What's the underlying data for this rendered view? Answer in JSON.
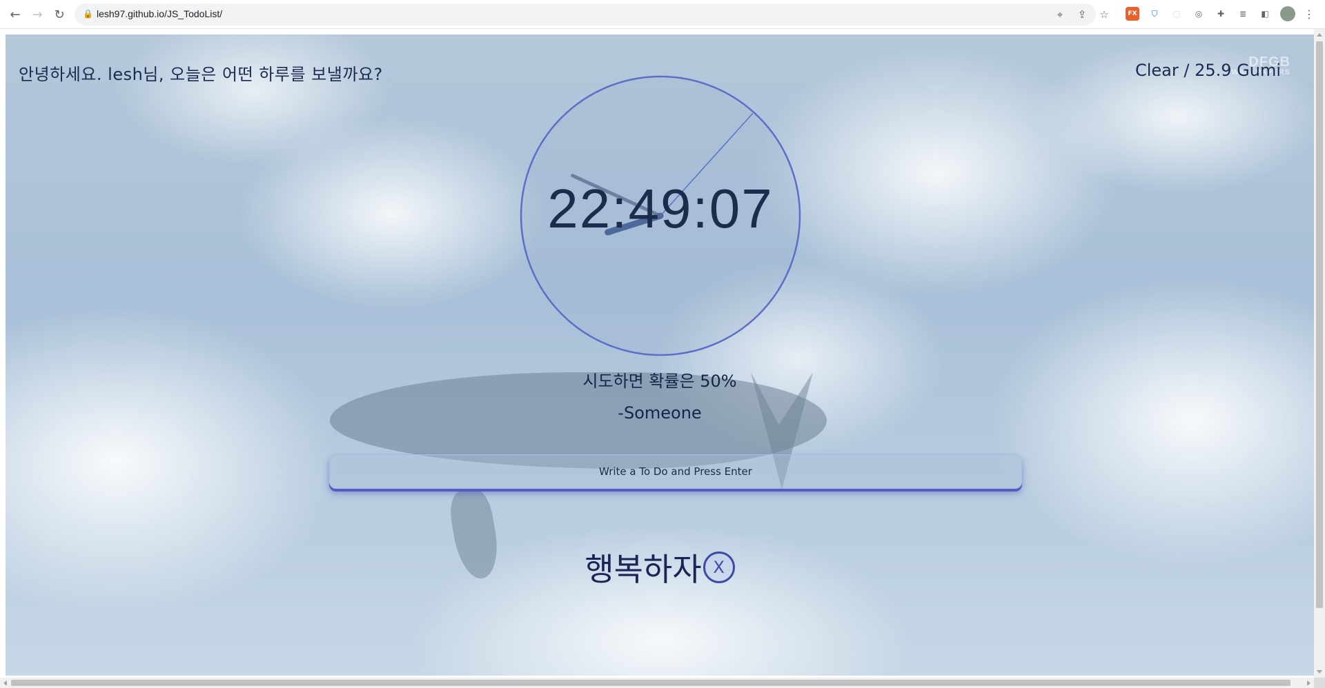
{
  "browser": {
    "url": "lesh97.github.io/JS_TodoList/",
    "nav_icons": [
      "back-arrow-icon",
      "forward-arrow-icon",
      "reload-icon"
    ],
    "ext_badge": "FX"
  },
  "page": {
    "greeting": "안녕하세요. lesh님, 오늘은 어떤 하루를 보낼까요?",
    "weather": "Clear / 25.9 Gumi",
    "watermark": {
      "line1": "DFGB",
      "line2": "WALLPAPERS"
    },
    "clock": {
      "time": "22:49:07",
      "hour_hand_hours": 22.82,
      "minute_hand_minutes": 49.1,
      "second_hand_seconds": 7,
      "ring_color": "#5c6ec8"
    },
    "quote": {
      "text": "시도하면 확률은 50%",
      "author": "-Someone"
    },
    "todo_form": {
      "placeholder": "Write a To Do and Press Enter"
    },
    "todos": [
      {
        "text": "행복하자",
        "delete_label": "X"
      }
    ]
  }
}
